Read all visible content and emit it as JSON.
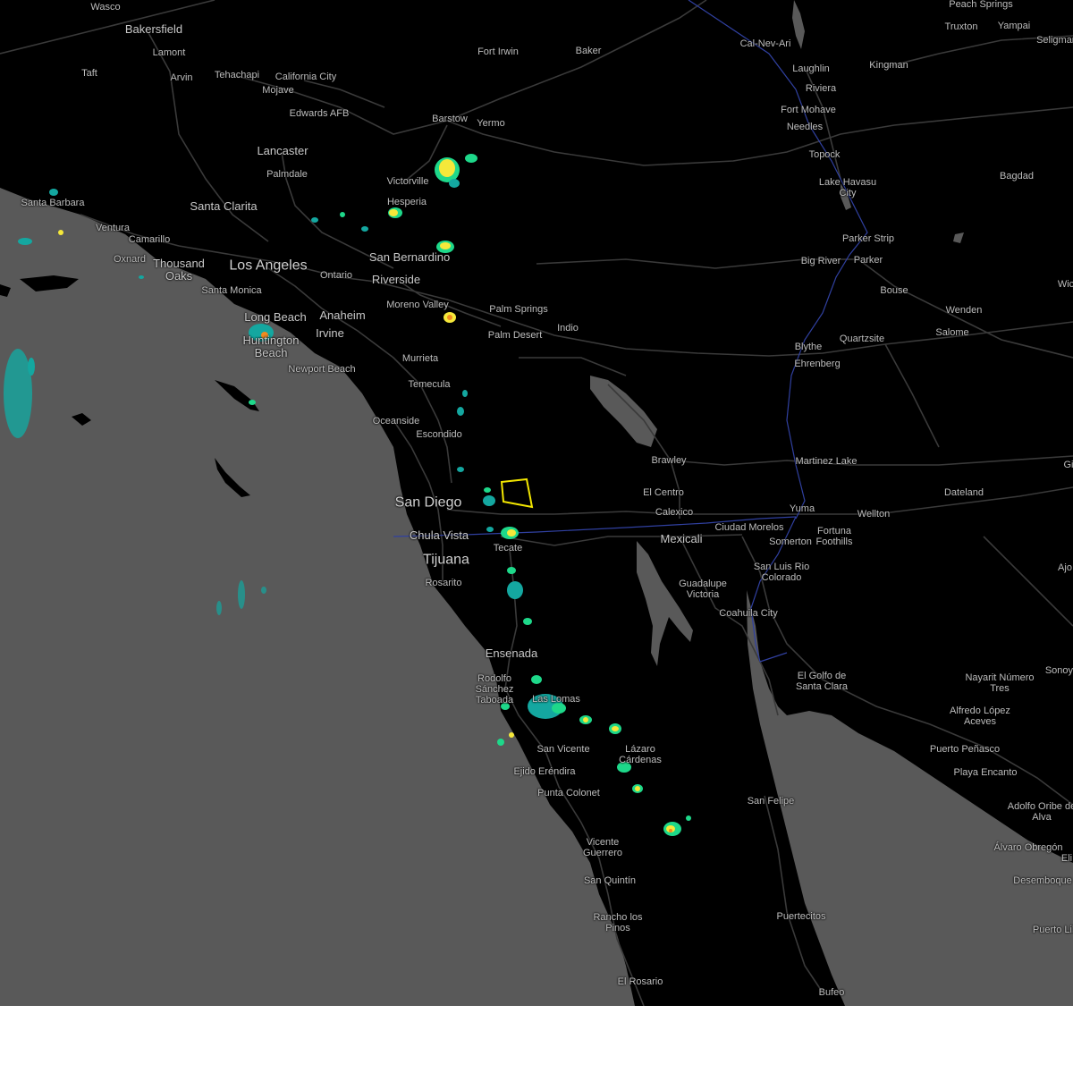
{
  "map": {
    "places": [
      {
        "name": "Wasco",
        "size": "small"
      },
      {
        "name": "Bakersfield",
        "size": "mid"
      },
      {
        "name": "Lamont",
        "size": "small"
      },
      {
        "name": "Arvin",
        "size": "small"
      },
      {
        "name": "Taft",
        "size": "small"
      },
      {
        "name": "Tehachapi",
        "size": "small"
      },
      {
        "name": "California City",
        "size": "small"
      },
      {
        "name": "Mojave",
        "size": "small"
      },
      {
        "name": "Fort Irwin",
        "size": "small"
      },
      {
        "name": "Baker",
        "size": "small"
      },
      {
        "name": "Cal-Nev-Ari",
        "size": "small"
      },
      {
        "name": "Peach Springs",
        "size": "small"
      },
      {
        "name": "Truxton",
        "size": "small"
      },
      {
        "name": "Yampai",
        "size": "small"
      },
      {
        "name": "Seligman",
        "size": "small"
      },
      {
        "name": "Laughlin",
        "size": "small"
      },
      {
        "name": "Kingman",
        "size": "small"
      },
      {
        "name": "Riviera",
        "size": "small"
      },
      {
        "name": "Fort Mohave",
        "size": "small"
      },
      {
        "name": "Needles",
        "size": "small"
      },
      {
        "name": "Edwards AFB",
        "size": "small"
      },
      {
        "name": "Barstow",
        "size": "small"
      },
      {
        "name": "Yermo",
        "size": "small"
      },
      {
        "name": "Lancaster",
        "size": "mid"
      },
      {
        "name": "Palmdale",
        "size": "small"
      },
      {
        "name": "Topock",
        "size": "small"
      },
      {
        "name": "Lake Havasu City",
        "size": "small"
      },
      {
        "name": "Bagdad",
        "size": "small"
      },
      {
        "name": "Victorville",
        "size": "small"
      },
      {
        "name": "Santa Barbara",
        "size": "small"
      },
      {
        "name": "Santa Clarita",
        "size": "mid"
      },
      {
        "name": "Hesperia",
        "size": "small"
      },
      {
        "name": "Ventura",
        "size": "small"
      },
      {
        "name": "Camarillo",
        "size": "small"
      },
      {
        "name": "Oxnard",
        "size": "small"
      },
      {
        "name": "Thousand Oaks",
        "size": "mid"
      },
      {
        "name": "Los Angeles",
        "size": "major"
      },
      {
        "name": "San Bernardino",
        "size": "mid"
      },
      {
        "name": "Ontario",
        "size": "small"
      },
      {
        "name": "Riverside",
        "size": "mid"
      },
      {
        "name": "Parker Strip",
        "size": "small"
      },
      {
        "name": "Big River",
        "size": "small"
      },
      {
        "name": "Parker",
        "size": "small"
      },
      {
        "name": "Santa Monica",
        "size": "small"
      },
      {
        "name": "Bouse",
        "size": "small"
      },
      {
        "name": "Wenden",
        "size": "small"
      },
      {
        "name": "Salome",
        "size": "small"
      },
      {
        "name": "Moreno Valley",
        "size": "small"
      },
      {
        "name": "Palm Springs",
        "size": "small"
      },
      {
        "name": "Long Beach",
        "size": "mid"
      },
      {
        "name": "Anaheim",
        "size": "mid"
      },
      {
        "name": "Palm Desert",
        "size": "small"
      },
      {
        "name": "Indio",
        "size": "small"
      },
      {
        "name": "Irvine",
        "size": "mid"
      },
      {
        "name": "Huntington Beach",
        "size": "mid"
      },
      {
        "name": "Blythe",
        "size": "small"
      },
      {
        "name": "Quartzsite",
        "size": "small"
      },
      {
        "name": "Ehrenberg",
        "size": "small"
      },
      {
        "name": "Murrieta",
        "size": "small"
      },
      {
        "name": "Newport Beach",
        "size": "small"
      },
      {
        "name": "Temecula",
        "size": "small"
      },
      {
        "name": "Oceanside",
        "size": "small"
      },
      {
        "name": "Escondido",
        "size": "small"
      },
      {
        "name": "Brawley",
        "size": "small"
      },
      {
        "name": "Martinez Lake",
        "size": "small"
      },
      {
        "name": "El Centro",
        "size": "small"
      },
      {
        "name": "Dateland",
        "size": "small"
      },
      {
        "name": "San Diego",
        "size": "major"
      },
      {
        "name": "Calexico",
        "size": "small"
      },
      {
        "name": "Yuma",
        "size": "small"
      },
      {
        "name": "Wellton",
        "size": "small"
      },
      {
        "name": "Ciudad Morelos",
        "size": "small"
      },
      {
        "name": "Fortuna Foothills",
        "size": "small"
      },
      {
        "name": "Somerton",
        "size": "small"
      },
      {
        "name": "Chula Vista",
        "size": "mid"
      },
      {
        "name": "Mexicali",
        "size": "mid"
      },
      {
        "name": "Tecate",
        "size": "small"
      },
      {
        "name": "Tijuana",
        "size": "major"
      },
      {
        "name": "San Luis Rio Colorado",
        "size": "small"
      },
      {
        "name": "Ajo",
        "size": "small"
      },
      {
        "name": "Rosarito",
        "size": "small"
      },
      {
        "name": "Guadalupe Victoria",
        "size": "small"
      },
      {
        "name": "Coahuila City",
        "size": "small"
      },
      {
        "name": "Ensenada",
        "size": "mid"
      },
      {
        "name": "El Golfo de Santa Clara",
        "size": "small"
      },
      {
        "name": "Sonoyta",
        "size": "small"
      },
      {
        "name": "Nayarit Número Tres",
        "size": "small"
      },
      {
        "name": "Rodolfo Sánchez Taboada",
        "size": "small"
      },
      {
        "name": "Las Lomas",
        "size": "small"
      },
      {
        "name": "Alfredo López Aceves",
        "size": "small"
      },
      {
        "name": "San Vicente",
        "size": "small"
      },
      {
        "name": "Lázaro Cárdenas",
        "size": "small"
      },
      {
        "name": "Puerto Peñasco",
        "size": "small"
      },
      {
        "name": "Ejido Eréndira",
        "size": "small"
      },
      {
        "name": "Playa Encanto",
        "size": "small"
      },
      {
        "name": "Punta Colonet",
        "size": "small"
      },
      {
        "name": "San Felipe",
        "size": "small"
      },
      {
        "name": "Adolfo Oribe de Alva",
        "size": "small"
      },
      {
        "name": "Vicente Guerrero",
        "size": "small"
      },
      {
        "name": "Álvaro Obregón",
        "size": "small"
      },
      {
        "name": "Desemboque",
        "size": "small"
      },
      {
        "name": "San Quintín",
        "size": "small"
      },
      {
        "name": "Rancho los Pinos",
        "size": "small"
      },
      {
        "name": "Puertecitos",
        "size": "small"
      },
      {
        "name": "Puerto Lib",
        "size": "small"
      },
      {
        "name": "El Rosario",
        "size": "small"
      },
      {
        "name": "Bufeo",
        "size": "small"
      },
      {
        "name": "Gi",
        "size": "small"
      },
      {
        "name": "Wic",
        "size": "small"
      },
      {
        "name": "Eli",
        "size": "small"
      }
    ],
    "colors": {
      "land": "#000000",
      "water": "#595959",
      "road": "#3a3a3a",
      "border": "#3040a0",
      "warning_polygon": "#f2e600",
      "radar_light": "#14a7a0",
      "radar_mid": "#1ed88a",
      "radar_strong": "#f5e83a",
      "radar_heavy": "#f08a20"
    }
  }
}
